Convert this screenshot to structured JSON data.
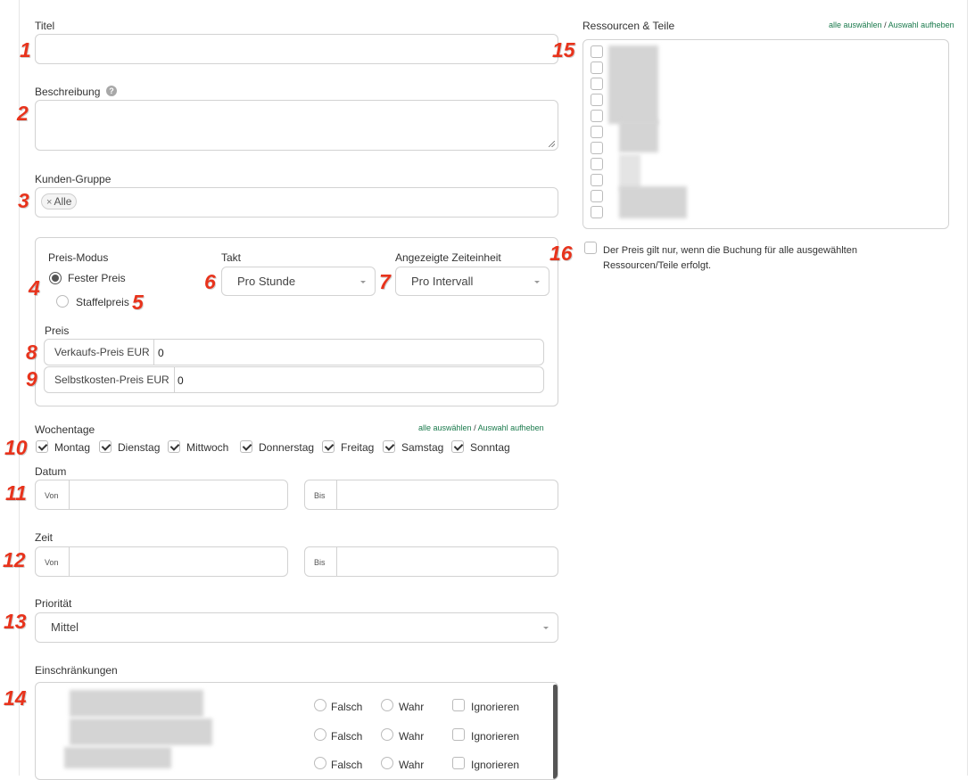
{
  "form": {
    "title_label": "Titel",
    "title_value": "",
    "description_label": "Beschreibung",
    "customer_group_label": "Kunden-Gruppe",
    "customer_group_tag": "Alle",
    "price_mode_label": "Preis-Modus",
    "price_mode_options": [
      "Fester Preis",
      "Staffelpreis"
    ],
    "price_mode_selected": "Fester Preis",
    "takt_label": "Takt",
    "takt_value": "Pro Stunde",
    "time_unit_label": "Angezeigte Zeiteinheit",
    "time_unit_value": "Pro Intervall",
    "price_label": "Preis",
    "sales_price_label": "Verkaufs-Preis EUR",
    "sales_price_value": "0",
    "cost_price_label": "Selbstkosten-Preis EUR",
    "cost_price_value": "0",
    "weekdays_label": "Wochentage",
    "weekdays_select_all": "alle auswählen",
    "weekdays_deselect": "Auswahl aufheben",
    "weekdays_separator": "/",
    "weekdays": [
      {
        "label": "Montag",
        "checked": true
      },
      {
        "label": "Dienstag",
        "checked": true
      },
      {
        "label": "Mittwoch",
        "checked": true
      },
      {
        "label": "Donnerstag",
        "checked": true
      },
      {
        "label": "Freitag",
        "checked": true
      },
      {
        "label": "Samstag",
        "checked": true
      },
      {
        "label": "Sonntag",
        "checked": true
      }
    ],
    "date_label": "Datum",
    "from_label": "Von",
    "to_label": "Bis",
    "time_label": "Zeit",
    "priority_label": "Priorität",
    "priority_value": "Mittel",
    "restrictions_label": "Einschränkungen",
    "restriction_options": [
      "Falsch",
      "Wahr",
      "Ignorieren"
    ],
    "resources_label": "Ressourcen & Teile",
    "resources_select_all": "alle auswählen",
    "resources_deselect": "Auswahl aufheben",
    "resources_note": "Der Preis gilt nur, wenn die Buchung für alle ausgewählten",
    "resources_note_line2": "Ressourcen/Teile erfolgt."
  },
  "markers": [
    "1",
    "2",
    "3",
    "4",
    "5",
    "6",
    "7",
    "8",
    "9",
    "10",
    "11",
    "12",
    "13",
    "14",
    "15",
    "16"
  ],
  "colors": {
    "accent_link": "#1a7a4c",
    "marker": "#e8331c"
  }
}
